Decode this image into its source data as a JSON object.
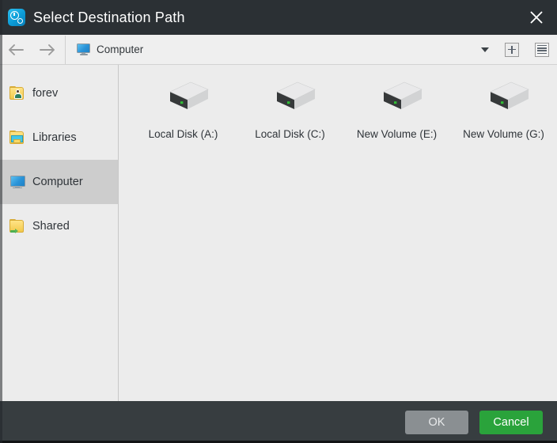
{
  "window": {
    "title": "Select Destination Path",
    "app_icon": "time-machine-icon",
    "close_icon": "close-icon",
    "titlebar_color": "#2b3034",
    "footer_color": "#373d40"
  },
  "toolbar": {
    "back_icon": "arrow-left-icon",
    "forward_icon": "arrow-right-icon",
    "address_icon": "computer-monitor-icon",
    "address_value": "Computer",
    "address_placeholder": "Computer",
    "dropdown_icon": "chevron-down-icon",
    "new_folder_icon": "plus-square-icon",
    "view_list_icon": "list-view-icon"
  },
  "sidebar": {
    "items": [
      {
        "label": "forev",
        "icon": "user-folder-icon",
        "selected": false
      },
      {
        "label": "Libraries",
        "icon": "libraries-folder-icon",
        "selected": false
      },
      {
        "label": "Computer",
        "icon": "computer-monitor-icon",
        "selected": true
      },
      {
        "label": "Shared",
        "icon": "shared-folder-icon",
        "selected": false
      }
    ]
  },
  "content": {
    "items": [
      {
        "label": "Local Disk (A:)",
        "icon": "hard-drive-icon"
      },
      {
        "label": "Local Disk (C:)",
        "icon": "hard-drive-icon"
      },
      {
        "label": "New Volume (E:)",
        "icon": "hard-drive-icon"
      },
      {
        "label": "New Volume (G:)",
        "icon": "hard-drive-icon"
      }
    ]
  },
  "footer": {
    "ok_label": "OK",
    "cancel_label": "Cancel",
    "ok_color": "#8a8f92",
    "cancel_color": "#2aa33b"
  }
}
